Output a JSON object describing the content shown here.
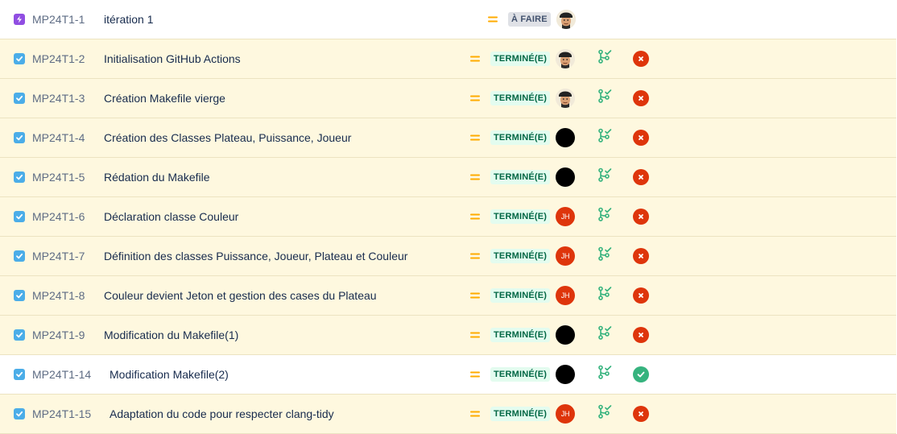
{
  "colors": {
    "row_highlight": "#fef8df",
    "epic": "#904ee2",
    "task_checkbox": "#4bade8",
    "priority_medium": "#ffab00",
    "done_lozenge_bg": "#e3fcef",
    "done_lozenge_text": "#006644",
    "todo_lozenge_bg": "#dfe1e6",
    "todo_lozenge_text": "#42526e",
    "dev_branch": "#36b37e",
    "build_failed": "#de350b",
    "build_success": "#36b37e"
  },
  "issues": [
    {
      "type": "epic",
      "type_icon": "lightning-icon",
      "key": "MP24T1-1",
      "summary": "itération 1",
      "priority_icon": "priority-medium-icon",
      "status": "À FAIRE",
      "assignee": "photo",
      "assignee_initials": "",
      "highlight": false,
      "dev_icon": "",
      "build": ""
    },
    {
      "type": "task",
      "type_icon": "checkbox-icon",
      "key": "MP24T1-2",
      "summary": "Initialisation GitHub Actions",
      "priority_icon": "priority-medium-icon",
      "status": "TERMINÉ(E)",
      "assignee": "photo",
      "assignee_initials": "",
      "highlight": true,
      "dev_icon": "branch-icon",
      "build": "failed"
    },
    {
      "type": "task",
      "type_icon": "checkbox-icon",
      "key": "MP24T1-3",
      "summary": "Création Makefile vierge",
      "priority_icon": "priority-medium-icon",
      "status": "TERMINÉ(E)",
      "assignee": "photo",
      "assignee_initials": "",
      "highlight": true,
      "dev_icon": "branch-icon",
      "build": "failed"
    },
    {
      "type": "task",
      "type_icon": "checkbox-icon",
      "key": "MP24T1-4",
      "summary": "Création des Classes Plateau, Puissance, Joueur",
      "priority_icon": "priority-medium-icon",
      "status": "TERMINÉ(E)",
      "assignee": "black",
      "assignee_initials": "",
      "highlight": true,
      "dev_icon": "branch-icon",
      "build": "failed"
    },
    {
      "type": "task",
      "type_icon": "checkbox-icon",
      "key": "MP24T1-5",
      "summary": "Rédation du Makefile",
      "priority_icon": "priority-medium-icon",
      "status": "TERMINÉ(E)",
      "assignee": "black",
      "assignee_initials": "",
      "highlight": true,
      "dev_icon": "branch-icon",
      "build": "failed"
    },
    {
      "type": "task",
      "type_icon": "checkbox-icon",
      "key": "MP24T1-6",
      "summary": "Déclaration classe Couleur",
      "priority_icon": "priority-medium-icon",
      "status": "TERMINÉ(E)",
      "assignee": "initials",
      "assignee_initials": "JH",
      "highlight": true,
      "dev_icon": "branch-icon",
      "build": "failed"
    },
    {
      "type": "task",
      "type_icon": "checkbox-icon",
      "key": "MP24T1-7",
      "summary": "Définition des classes Puissance, Joueur, Plateau et Couleur",
      "priority_icon": "priority-medium-icon",
      "status": "TERMINÉ(E)",
      "assignee": "initials",
      "assignee_initials": "JH",
      "highlight": true,
      "dev_icon": "branch-icon",
      "build": "failed"
    },
    {
      "type": "task",
      "type_icon": "checkbox-icon",
      "key": "MP24T1-8",
      "summary": "Couleur devient Jeton et gestion des cases du Plateau",
      "priority_icon": "priority-medium-icon",
      "status": "TERMINÉ(E)",
      "assignee": "initials",
      "assignee_initials": "JH",
      "highlight": true,
      "dev_icon": "branch-icon",
      "build": "failed"
    },
    {
      "type": "task",
      "type_icon": "checkbox-icon",
      "key": "MP24T1-9",
      "summary": "Modification du Makefile(1)",
      "priority_icon": "priority-medium-icon",
      "status": "TERMINÉ(E)",
      "assignee": "black",
      "assignee_initials": "",
      "highlight": true,
      "dev_icon": "branch-icon",
      "build": "failed"
    },
    {
      "type": "task",
      "type_icon": "checkbox-icon",
      "key": "MP24T1-14",
      "summary": "Modification Makefile(2)",
      "priority_icon": "priority-medium-icon",
      "status": "TERMINÉ(E)",
      "assignee": "black",
      "assignee_initials": "",
      "highlight": false,
      "dev_icon": "branch-icon",
      "build": "success"
    },
    {
      "type": "task",
      "type_icon": "checkbox-icon",
      "key": "MP24T1-15",
      "summary": "Adaptation du code pour respecter clang-tidy",
      "priority_icon": "priority-medium-icon",
      "status": "TERMINÉ(E)",
      "assignee": "initials",
      "assignee_initials": "JH",
      "highlight": true,
      "dev_icon": "branch-icon",
      "build": "failed"
    }
  ]
}
